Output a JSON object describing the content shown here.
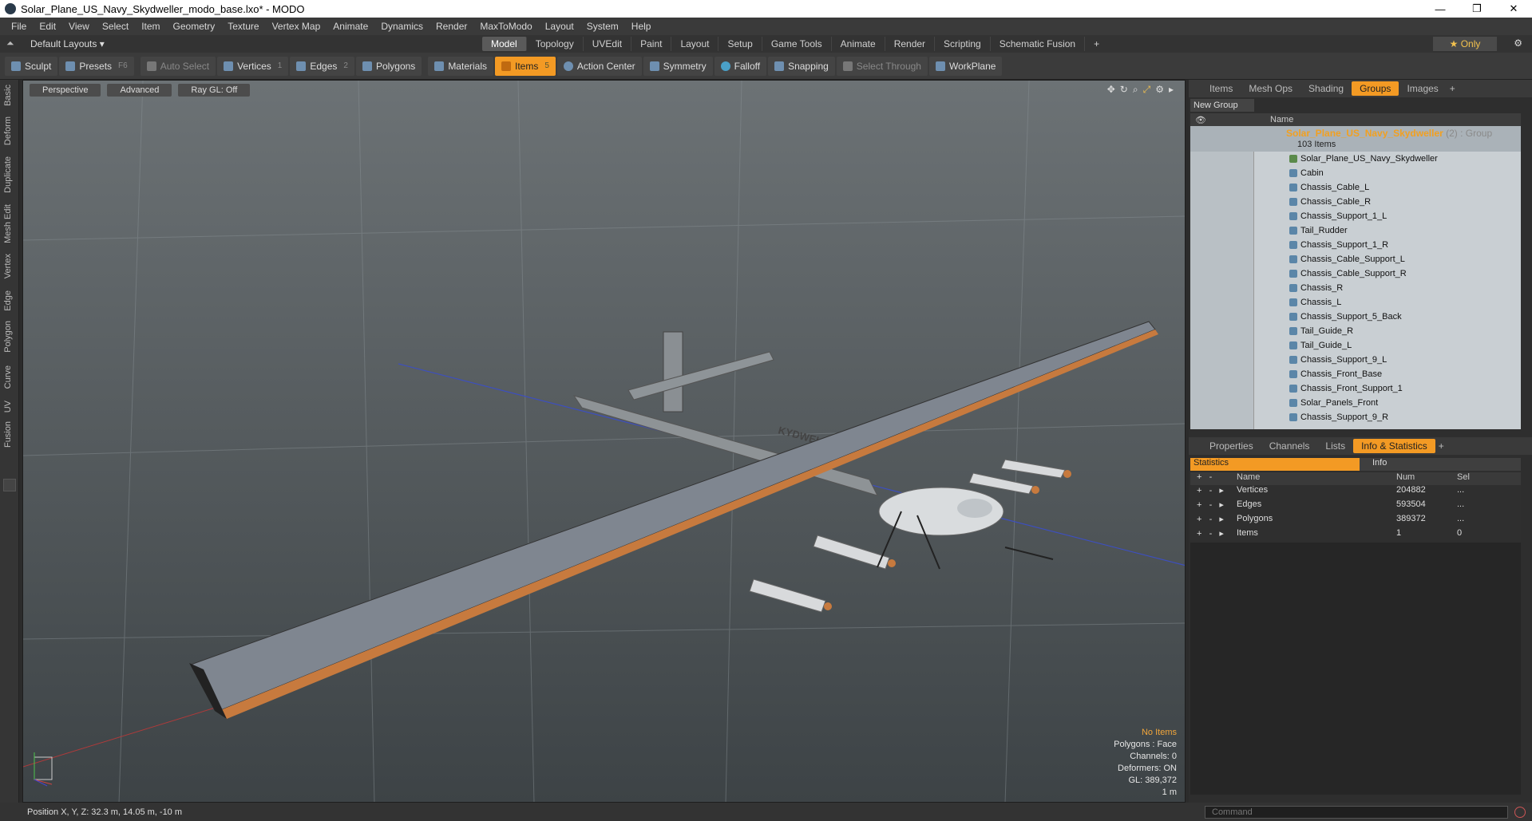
{
  "window": {
    "title": "Solar_Plane_US_Navy_Skydweller_modo_base.lxo* - MODO",
    "minimize": "—",
    "maximize": "❐",
    "close": "✕"
  },
  "menu": [
    "File",
    "Edit",
    "View",
    "Select",
    "Item",
    "Geometry",
    "Texture",
    "Vertex Map",
    "Animate",
    "Dynamics",
    "Render",
    "MaxToModo",
    "Layout",
    "System",
    "Help"
  ],
  "layoutbar": {
    "layouts_label": "Default Layouts ▾",
    "tabs": [
      "Model",
      "Topology",
      "UVEdit",
      "Paint",
      "Layout",
      "Setup",
      "Game Tools",
      "Animate",
      "Render",
      "Scripting",
      "Schematic Fusion"
    ],
    "active_tab": "Model",
    "only_label": "★  Only"
  },
  "toolbar": {
    "sculpt": "Sculpt",
    "presets": "Presets",
    "presets_key": "F6",
    "auto_select": "Auto Select",
    "vertices": "Vertices",
    "vertices_count": "1",
    "edges": "Edges",
    "edges_count": "2",
    "polygons": "Polygons",
    "materials": "Materials",
    "items": "Items",
    "items_count": "5",
    "action_center": "Action Center",
    "symmetry": "Symmetry",
    "falloff": "Falloff",
    "snapping": "Snapping",
    "select_through": "Select Through",
    "workplane": "WorkPlane"
  },
  "left_tabs": [
    "Basic",
    "Deform",
    "Duplicate",
    "Mesh Edit",
    "Vertex",
    "Edge",
    "Polygon",
    "Curve",
    "UV",
    "Fusion"
  ],
  "viewport": {
    "perspective": "Perspective",
    "advanced": "Advanced",
    "raygl": "Ray GL: Off",
    "info": {
      "no_items": "No Items",
      "polygons": "Polygons : Face",
      "channels": "Channels: 0",
      "deformers": "Deformers: ON",
      "gl": "GL: 389,372",
      "scale": "1 m"
    },
    "hull_text": "KYDWELL"
  },
  "right_top_tabs": [
    "Items",
    "Mesh Ops",
    "Shading",
    "Groups",
    "Images"
  ],
  "right_top_active": "Groups",
  "new_group": "New Group",
  "list_header_name": "Name",
  "group": {
    "name": "Solar_Plane_US_Navy_Skydweller",
    "type": " (2) : Group",
    "count": "103 Items"
  },
  "items": [
    "Solar_Plane_US_Navy_Skydweller",
    "Cabin",
    "Chassis_Cable_L",
    "Chassis_Cable_R",
    "Chassis_Support_1_L",
    "Tail_Rudder",
    "Chassis_Support_1_R",
    "Chassis_Cable_Support_L",
    "Chassis_Cable_Support_R",
    "Chassis_R",
    "Chassis_L",
    "Chassis_Support_5_Back",
    "Tail_Guide_R",
    "Tail_Guide_L",
    "Chassis_Support_9_L",
    "Chassis_Front_Base",
    "Chassis_Front_Support_1",
    "Solar_Panels_Front",
    "Chassis_Support_9_R"
  ],
  "right_bottom_tabs": [
    "Properties",
    "Channels",
    "Lists",
    "Info & Statistics"
  ],
  "right_bottom_active": "Info & Statistics",
  "stats": {
    "tab_statistics": "Statistics",
    "tab_info": "Info",
    "col_name": "Name",
    "col_num": "Num",
    "col_sel": "Sel",
    "rows": [
      {
        "name": "Vertices",
        "num": "204882",
        "sel": "..."
      },
      {
        "name": "Edges",
        "num": "593504",
        "sel": "..."
      },
      {
        "name": "Polygons",
        "num": "389372",
        "sel": "..."
      },
      {
        "name": "Items",
        "num": "1",
        "sel": "0"
      }
    ]
  },
  "status": {
    "position": "Position X, Y, Z:   32.3 m, 14.05 m, -10 m"
  },
  "command": {
    "placeholder": "Command"
  },
  "colors": {
    "accent": "#f39a24",
    "group_name": "#f2a020"
  }
}
